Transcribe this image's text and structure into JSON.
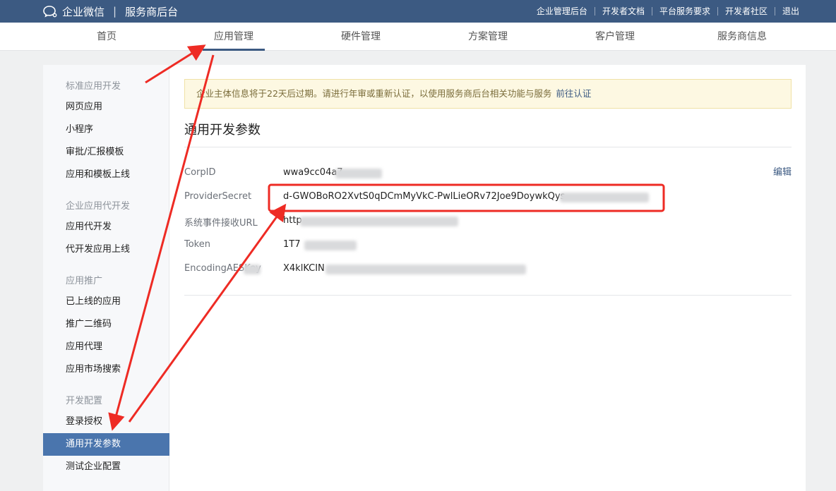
{
  "header": {
    "brand": "企业微信",
    "separator": "|",
    "console_title": "服务商后台",
    "links": [
      "企业管理后台",
      "开发者文档",
      "平台服务要求",
      "开发者社区",
      "退出"
    ]
  },
  "nav": {
    "tabs": [
      "首页",
      "应用管理",
      "硬件管理",
      "方案管理",
      "客户管理",
      "服务商信息"
    ],
    "active": "应用管理"
  },
  "sidebar": {
    "groups": [
      {
        "title": "标准应用开发",
        "items": [
          "网页应用",
          "小程序",
          "审批/汇报模板",
          "应用和模板上线"
        ]
      },
      {
        "title": "企业应用代开发",
        "items": [
          "应用代开发",
          "代开发应用上线"
        ]
      },
      {
        "title": "应用推广",
        "items": [
          "已上线的应用",
          "推广二维码",
          "应用代理",
          "应用市场搜索"
        ]
      },
      {
        "title": "开发配置",
        "items": [
          "登录授权",
          "通用开发参数",
          "测试企业配置"
        ]
      }
    ],
    "active": "通用开发参数"
  },
  "notice": {
    "text": "企业主体信息将于22天后过期。请进行年审或重新认证，以使用服务商后台相关功能与服务",
    "link": "前往认证"
  },
  "section": {
    "title": "通用开发参数",
    "edit": "编辑"
  },
  "params": [
    {
      "key": "CorpID",
      "value": "wwa9cc04a7"
    },
    {
      "key": "ProviderSecret",
      "value": "d-GWOBoRO2XvtS0qDCmMyVkC-PwlLieORv72Joe9DoywkQys"
    },
    {
      "key": "系统事件接收URL",
      "value": "http"
    },
    {
      "key": "Token",
      "value": "1T7"
    },
    {
      "key": "EncodingAESKey",
      "value": "X4klKCIN"
    }
  ],
  "colors": {
    "topbar": "#3c5a82",
    "accent": "#4a75ad",
    "annotation": "#ee2b24"
  }
}
